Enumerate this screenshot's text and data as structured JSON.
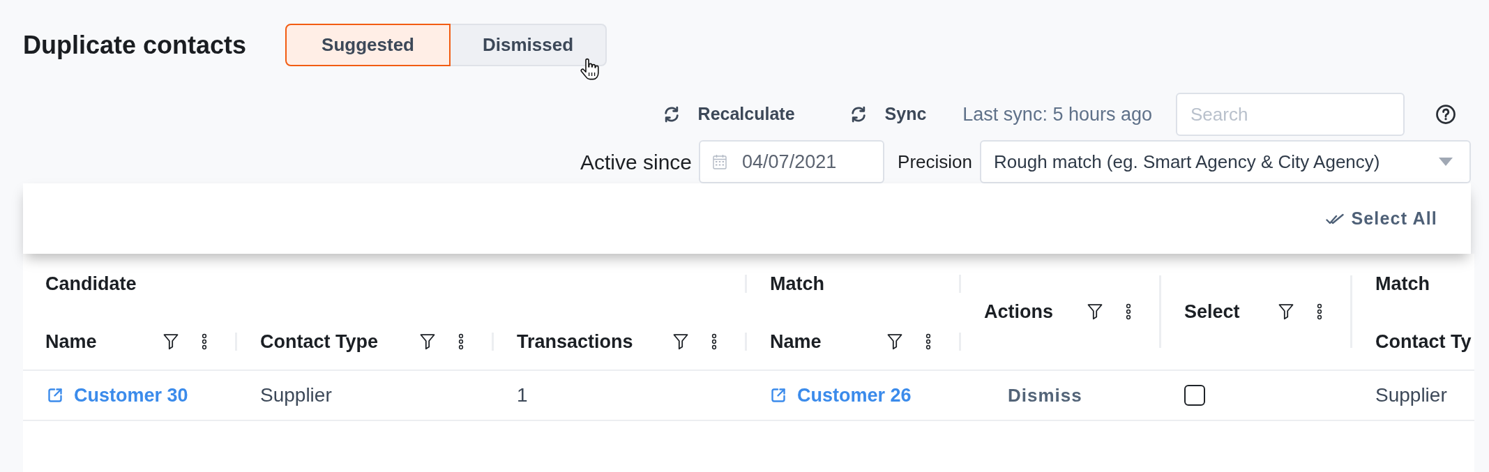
{
  "page": {
    "title": "Duplicate contacts"
  },
  "tabs": [
    {
      "label": "Suggested",
      "selected": true
    },
    {
      "label": "Dismissed",
      "selected": false
    }
  ],
  "toolbar": {
    "actions": [
      {
        "label": "Recalculate"
      },
      {
        "label": "Sync"
      }
    ],
    "last_sync": "Last sync: 5 hours ago",
    "search": {
      "placeholder": "Search"
    }
  },
  "filters": {
    "active_since": {
      "label": "Active since",
      "value": "04/07/2021"
    },
    "precision": {
      "label": "Precision",
      "value": "Rough match (eg. Smart Agency & City Agency)"
    }
  },
  "select_all": {
    "label": "Select All"
  },
  "table": {
    "header_groups": [
      {
        "label": "Candidate",
        "columns": [
          {
            "label": "Name",
            "filterable": true
          },
          {
            "label": "Contact Type",
            "filterable": true
          },
          {
            "label": "Transactions",
            "filterable": true
          }
        ]
      },
      {
        "label": "Match",
        "columns": [
          {
            "label": "Name",
            "filterable": true
          }
        ]
      },
      {
        "columns": [
          {
            "label": "Actions",
            "filterable": true
          }
        ]
      },
      {
        "columns": [
          {
            "label": "Select",
            "filterable": true
          }
        ]
      },
      {
        "label": "Match",
        "columns": [
          {
            "label": "Contact Ty",
            "filterable": false
          }
        ]
      }
    ],
    "rows": [
      {
        "cells": [
          {
            "kind": "link",
            "text": "Customer 30"
          },
          {
            "kind": "text",
            "text": "Supplier"
          },
          {
            "kind": "text",
            "text": "1"
          },
          {
            "kind": "link",
            "text": "Customer 26"
          },
          {
            "kind": "action",
            "text": "Dismiss"
          },
          {
            "kind": "checkbox",
            "checked": false
          },
          {
            "kind": "text",
            "text": "Supplier"
          }
        ]
      }
    ]
  }
}
